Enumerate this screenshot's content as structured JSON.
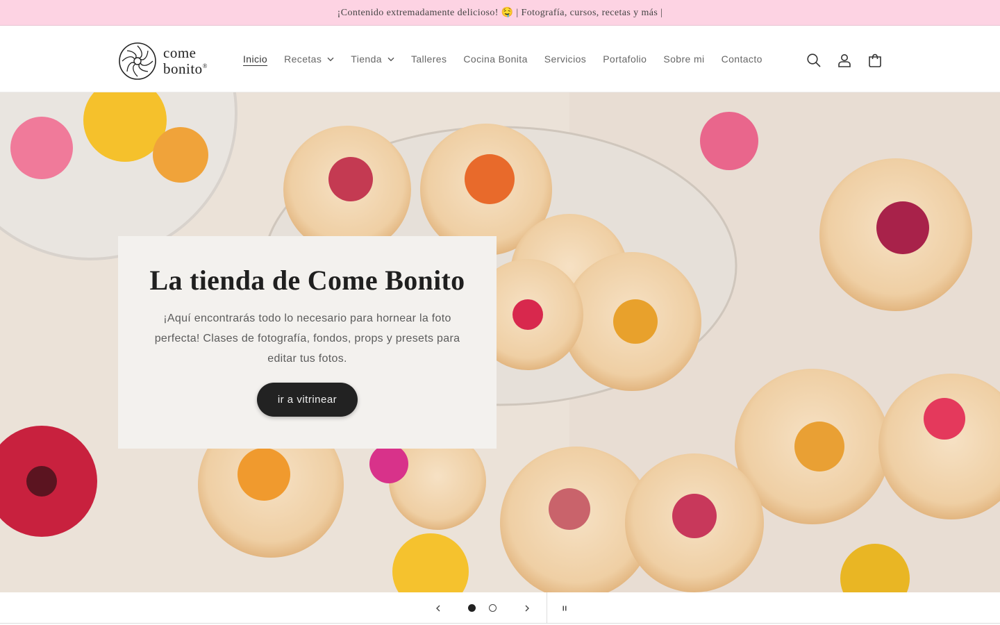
{
  "announcement": {
    "text": "¡Contenido extremadamente delicioso! 🤤 | Fotografía, cursos, recetas y más |"
  },
  "brand": {
    "line1": "come",
    "line2": "bonito",
    "mark": "®"
  },
  "nav": {
    "items": [
      {
        "label": "Inicio",
        "active": true,
        "dropdown": false
      },
      {
        "label": "Recetas",
        "active": false,
        "dropdown": true
      },
      {
        "label": "Tienda",
        "active": false,
        "dropdown": true
      },
      {
        "label": "Talleres",
        "active": false,
        "dropdown": false
      },
      {
        "label": "Cocina Bonita",
        "active": false,
        "dropdown": false
      },
      {
        "label": "Servicios",
        "active": false,
        "dropdown": false
      },
      {
        "label": "Portafolio",
        "active": false,
        "dropdown": false
      },
      {
        "label": "Sobre mi",
        "active": false,
        "dropdown": false
      },
      {
        "label": "Contacto",
        "active": false,
        "dropdown": false
      }
    ]
  },
  "header_icons": [
    "search-icon",
    "account-icon",
    "cart-icon"
  ],
  "hero": {
    "title": "La tienda de Come Bonito",
    "text": "¡Aquí encontrarás todo lo necesario para hornear la foto perfecta! Clases de fotografía, fondos, props y presets para editar tus fotos.",
    "button_label": "ir a vitrinear"
  },
  "slider": {
    "current": 1,
    "total": 2
  },
  "colors": {
    "announcement_bg": "#fdd3e3",
    "button_bg": "#222222",
    "card_bg": "#f3f1ee"
  }
}
